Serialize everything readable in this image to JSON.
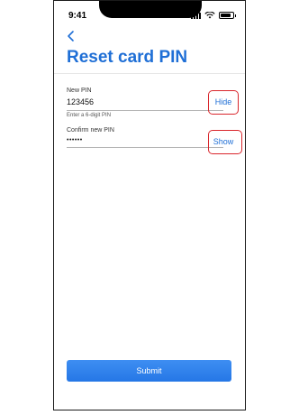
{
  "status_bar": {
    "time": "9:41"
  },
  "header": {
    "back_icon": "chevron-left-icon",
    "title": "Reset card PIN"
  },
  "form": {
    "new_pin": {
      "label": "New PIN",
      "value": "123456",
      "helper": "Enter a 6-digit PIN",
      "toggle_label": "Hide"
    },
    "confirm_pin": {
      "label": "Confirm new PIN",
      "value": "••••••",
      "toggle_label": "Show"
    }
  },
  "submit_label": "Submit",
  "colors": {
    "accent": "#1f6fd6",
    "button": "#2a7de8",
    "highlight": "#d9262c"
  }
}
